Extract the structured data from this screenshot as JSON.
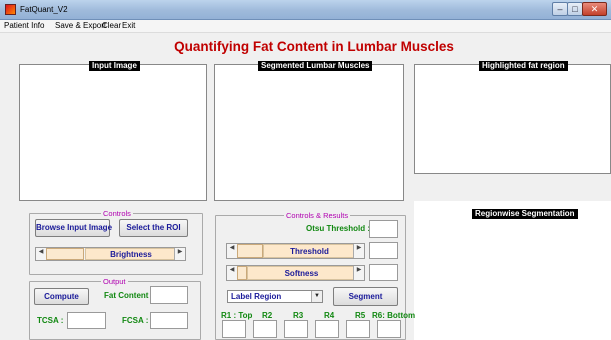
{
  "window": {
    "title": "FatQuant_V2"
  },
  "menu": [
    "Patient Info",
    "Save & Export",
    "Clear",
    "Exit"
  ],
  "page": {
    "title": "Quantifying Fat Content in Lumbar Muscles"
  },
  "panes": {
    "input": "Input Image",
    "segmented": "Segmented Lumbar Muscles",
    "highlighted": "Highlighted fat region",
    "regionwise": "Regionwise Segmentation"
  },
  "controls": {
    "legend": "Controls",
    "browse": "Browse Input Image",
    "select_roi": "Select the ROI",
    "brightness": "Brightness"
  },
  "output": {
    "legend": "Output",
    "compute": "Compute",
    "fat_content": "Fat Content :",
    "tcsa": "TCSA :",
    "fcsa": "FCSA :"
  },
  "results": {
    "legend": "Controls & Results",
    "otsu": "Otsu Threshold :",
    "threshold": "Threshold",
    "softness": "Softness",
    "label_region": "Label Region",
    "segment": "Segment",
    "regions": [
      "R1 : Top",
      "R2",
      "R3",
      "R4",
      "R5",
      "R6: Bottom"
    ]
  }
}
